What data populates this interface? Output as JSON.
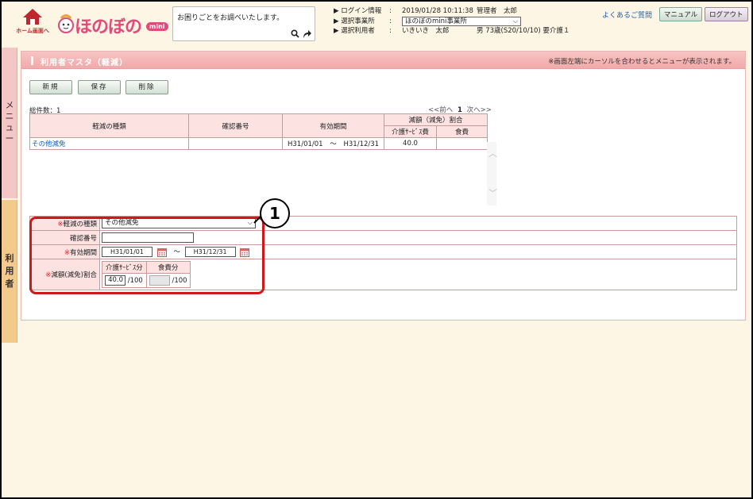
{
  "header": {
    "home_label": "ホーム画面へ",
    "logo_text": "ほのぼの",
    "logo_badge": "mini",
    "help_text": "お困りごとをお調べいたします。",
    "info": {
      "login_label": "ログイン情報",
      "login_time": "2019/01/28 10:11:38",
      "login_user": "管理者　太郎",
      "office_label": "選択事業所",
      "office_value": "ほのぼのmini事業所",
      "user_label": "選択利用者",
      "user_name": "いきいき　太郎",
      "user_detail": "男 73歳(S20/10/10) 要介護１"
    },
    "faq_link": "よくあるご質問",
    "manual_button": "マニュアル",
    "logout_button": "ログアウト"
  },
  "side": {
    "menu_label": "メニュー",
    "user_label": "利用者"
  },
  "panel": {
    "title": "利用者マスタ（軽減）",
    "note": "※画面左端にカーソルを合わせるとメニューが表示されます。",
    "buttons": {
      "new": "新規",
      "save": "保存",
      "delete": "削除"
    },
    "total": "総件数：1",
    "pager": {
      "prev": "<<前へ",
      "page": "1",
      "next": "次へ>>"
    }
  },
  "list": {
    "headers": {
      "type": "軽減の種類",
      "confirm": "確認番号",
      "period": "有効期間",
      "ratio_group": "減額（減免）割合",
      "care": "介護ｻｰﾋﾞｽ費",
      "food": "食費"
    },
    "rows": [
      {
        "type": "その他減免",
        "confirm": "",
        "start": "H31/01/01",
        "tilde": "～",
        "end": "H31/12/31",
        "care": "40.0",
        "food": ""
      }
    ]
  },
  "form": {
    "type_label": "軽減の種類",
    "type_value": "その他減免",
    "confirm_label": "確認番号",
    "period_label": "有効期間",
    "start_date": "H31/01/01",
    "end_date": "H31/12/31",
    "ratio_label": "減額(減免)割合",
    "care_col": "介護ｻｰﾋﾞｽ分",
    "food_col": "食費分",
    "care_value": "40.0",
    "per100": "/100",
    "required_mark": "※",
    "tilde": "～"
  },
  "annotation": {
    "callout": "1"
  },
  "colors": {
    "accent_pink": "#f2a9a9",
    "header_bg": "#fdf6e4",
    "highlight": "#d01818",
    "link": "#1a5fb4"
  }
}
